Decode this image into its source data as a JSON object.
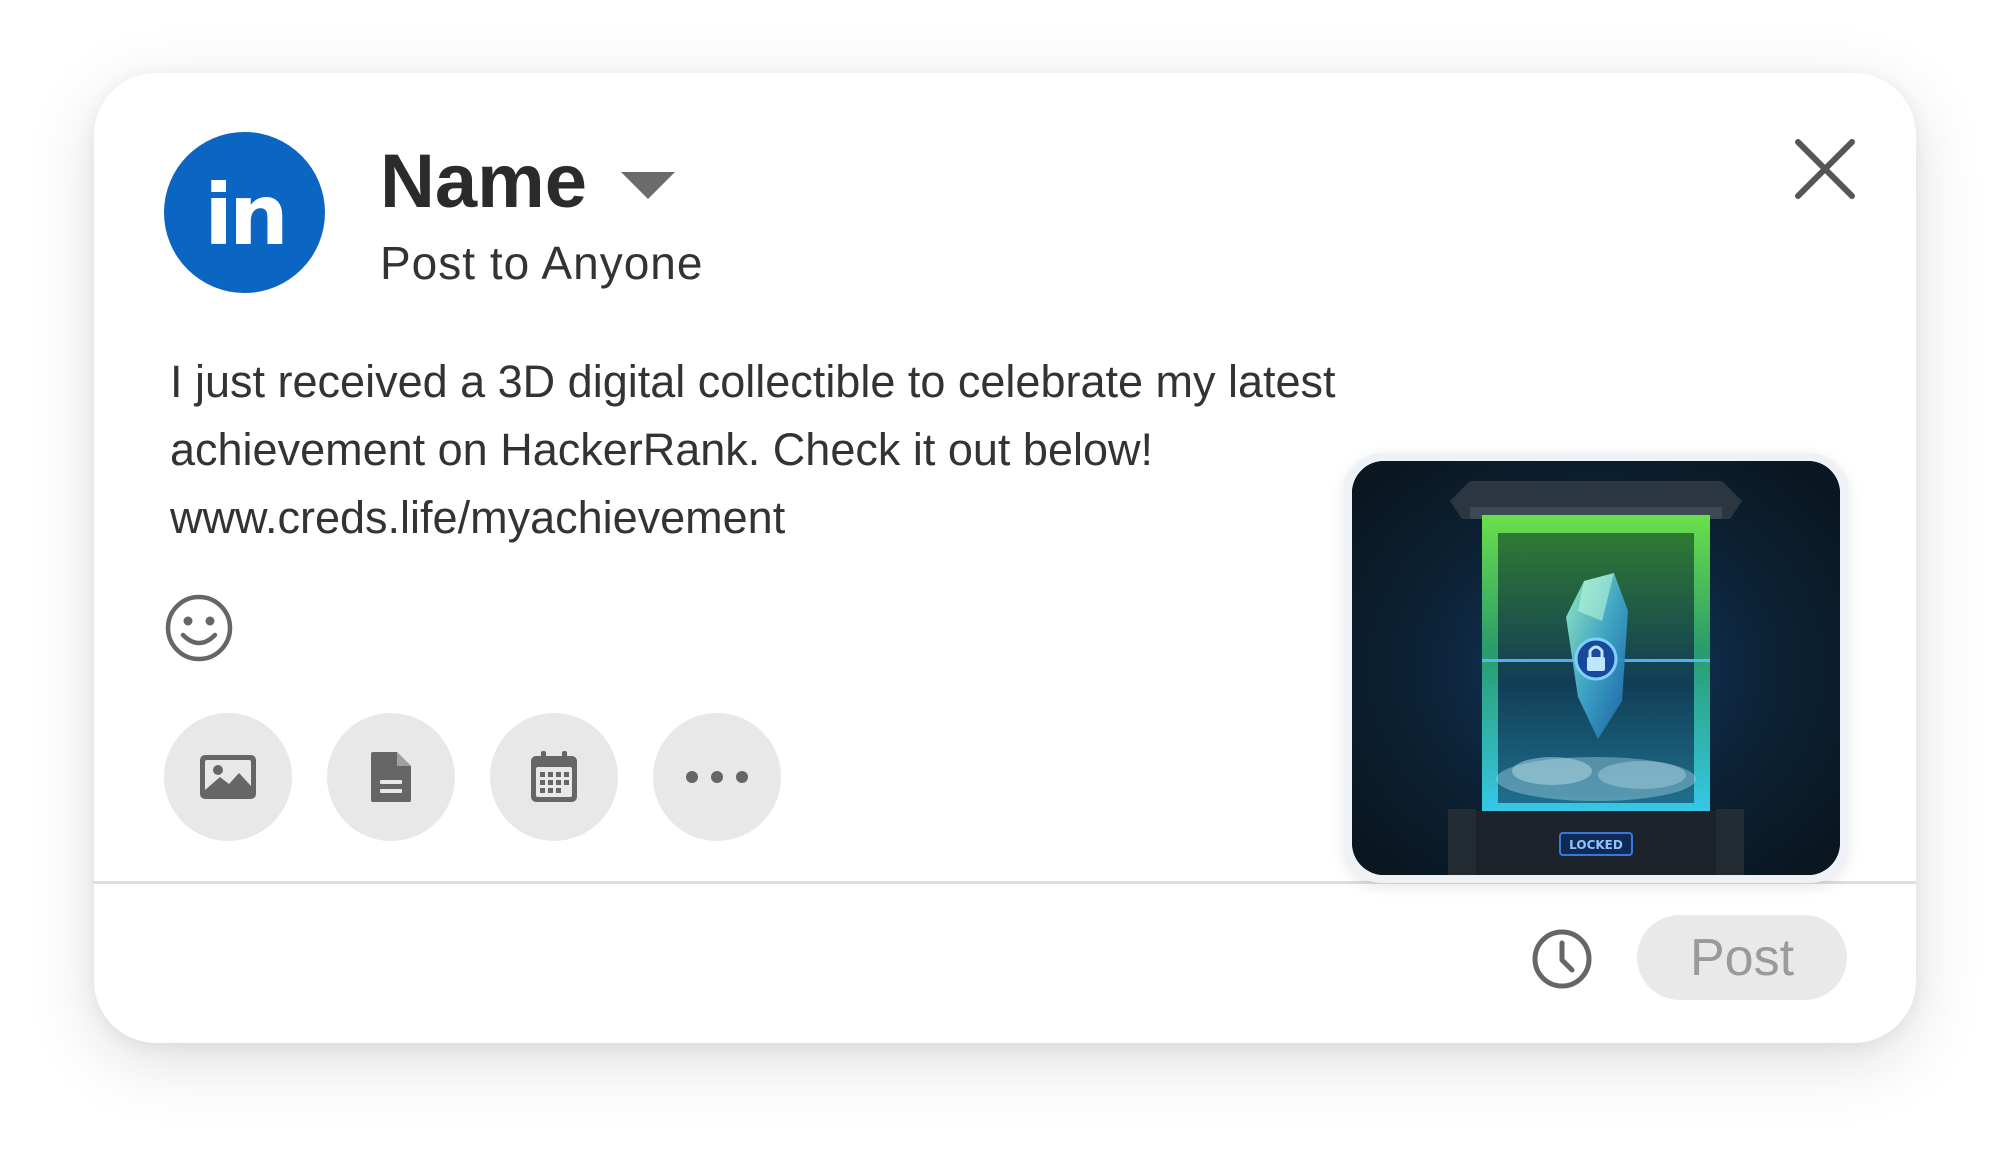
{
  "author": {
    "logo_text": "in",
    "name": "Name",
    "visibility": "Post to Anyone"
  },
  "post": {
    "text": "I just received a 3D digital collectible to celebrate my latest achievement on HackerRank. Check it out below! www.creds.life/myachievement"
  },
  "attachment": {
    "badge_text": "LOCKED"
  },
  "toolbar": {
    "items": [
      "image-icon",
      "document-icon",
      "calendar-icon",
      "more-icon"
    ]
  },
  "footer": {
    "post_label": "Post"
  },
  "colors": {
    "brand": "#0a66c2",
    "post_button_bg": "#e9e9e9",
    "post_button_text": "#9a9a9a"
  }
}
